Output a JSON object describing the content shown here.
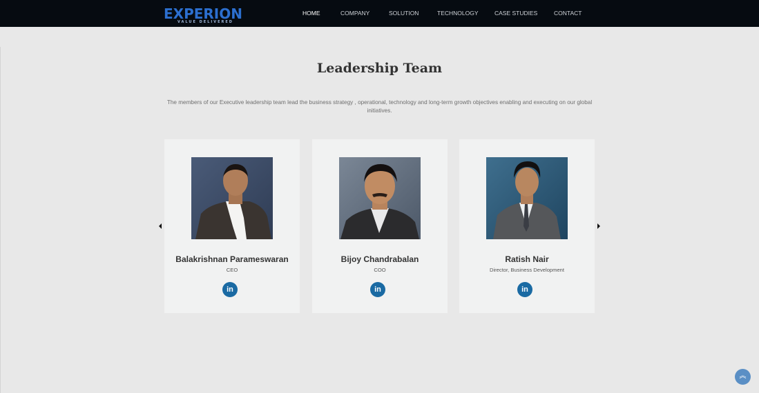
{
  "header": {
    "logo_text": "EXPERION",
    "logo_tagline": "VALUE DELIVERED",
    "nav": [
      {
        "label": "HOME",
        "active": true
      },
      {
        "label": "COMPANY",
        "active": false
      },
      {
        "label": "SOLUTION",
        "active": false
      },
      {
        "label": "TECHNOLOGY",
        "active": false
      },
      {
        "label": "CASE STUDIES",
        "active": false
      },
      {
        "label": "CONTACT",
        "active": false
      }
    ]
  },
  "section": {
    "title": "Leadership Team",
    "intro": "The members of our Executive leadership team lead the business strategy , operational, technology and long-term growth objectives enabling and executing on our global initiatives."
  },
  "team": [
    {
      "name": "Balakrishnan Parameswaran",
      "role": "CEO",
      "social_icon": "linkedin-icon",
      "social_label": "in"
    },
    {
      "name": "Bijoy Chandrabalan",
      "role": "COO",
      "social_icon": "linkedin-icon",
      "social_label": "in"
    },
    {
      "name": "Ratish Nair",
      "role": "Director, Business Development",
      "social_icon": "linkedin-icon",
      "social_label": "in"
    }
  ],
  "carousel": {
    "prev_icon": "chevron-left-icon",
    "next_icon": "chevron-right-icon"
  },
  "scroll_top": {
    "icon": "double-chevron-up-icon",
    "glyph": "︽"
  },
  "colors": {
    "navbar_bg": "#060b11",
    "brand_blue": "#2c6fcf",
    "linkedin_blue": "#1a6aa3",
    "page_bg": "#e8e8e8",
    "card_bg": "#f1f2f2",
    "scroll_top_bg": "#5a8fc5"
  }
}
